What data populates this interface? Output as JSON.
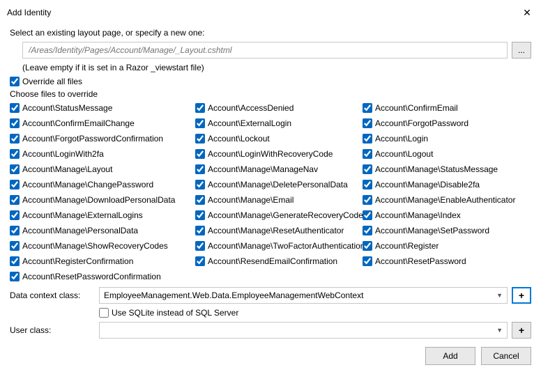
{
  "title": "Add Identity",
  "prompt": "Select an existing layout page, or specify a new one:",
  "layoutPathPlaceholder": "/Areas/Identity/Pages/Account/Manage/_Layout.cshtml",
  "ellipsis": "...",
  "hint": "(Leave empty if it is set in a Razor _viewstart file)",
  "overrideAllLabel": "Override all files",
  "chooseLabel": "Choose files to override",
  "files": {
    "col1": [
      "Account\\StatusMessage",
      "Account\\ConfirmEmailChange",
      "Account\\ForgotPasswordConfirmation",
      "Account\\LoginWith2fa",
      "Account\\Manage\\Layout",
      "Account\\Manage\\ChangePassword",
      "Account\\Manage\\DownloadPersonalData",
      "Account\\Manage\\ExternalLogins",
      "Account\\Manage\\PersonalData",
      "Account\\Manage\\ShowRecoveryCodes",
      "Account\\RegisterConfirmation",
      "Account\\ResetPasswordConfirmation"
    ],
    "col2": [
      "Account\\AccessDenied",
      "Account\\ExternalLogin",
      "Account\\Lockout",
      "Account\\LoginWithRecoveryCode",
      "Account\\Manage\\ManageNav",
      "Account\\Manage\\DeletePersonalData",
      "Account\\Manage\\Email",
      "Account\\Manage\\GenerateRecoveryCodes",
      "Account\\Manage\\ResetAuthenticator",
      "Account\\Manage\\TwoFactorAuthentication",
      "Account\\ResendEmailConfirmation"
    ],
    "col3": [
      "Account\\ConfirmEmail",
      "Account\\ForgotPassword",
      "Account\\Login",
      "Account\\Logout",
      "Account\\Manage\\StatusMessage",
      "Account\\Manage\\Disable2fa",
      "Account\\Manage\\EnableAuthenticator",
      "Account\\Manage\\Index",
      "Account\\Manage\\SetPassword",
      "Account\\Register",
      "Account\\ResetPassword"
    ]
  },
  "dataContextLabel": "Data context class:",
  "dataContextValue": "EmployeeManagement.Web.Data.EmployeeManagementWebContext",
  "sqliteLabel": "Use SQLite instead of SQL Server",
  "userClassLabel": "User class:",
  "userClassValue": "",
  "addButton": "Add",
  "cancelButton": "Cancel",
  "plus": "+"
}
